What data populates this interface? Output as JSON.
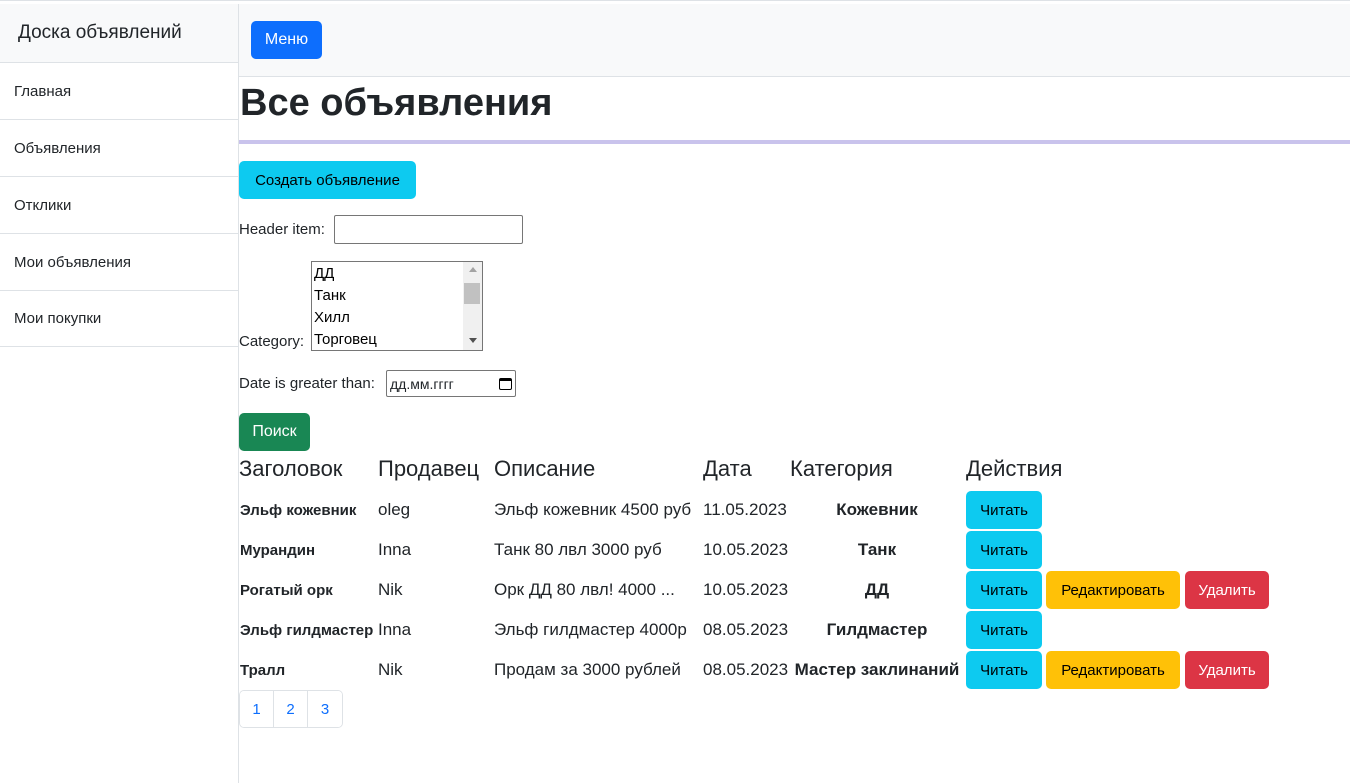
{
  "sidebar": {
    "heading": "Доска объявлений",
    "items": [
      {
        "label": "Главная"
      },
      {
        "label": "Объявления"
      },
      {
        "label": "Отклики"
      },
      {
        "label": "Мои объявления"
      },
      {
        "label": "Мои покупки"
      }
    ]
  },
  "topnav": {
    "menu_label": "Меню"
  },
  "main": {
    "title": "Все объявления",
    "create_label": "Создать объявление",
    "filters": {
      "header_label": "Header item:",
      "header_value": "",
      "category_label": "Category:",
      "category_options": [
        "ДД",
        "Танк",
        "Хилл",
        "Торговец"
      ],
      "date_label": "Date is greater than:",
      "date_placeholder": "дд.мм.гггг",
      "search_label": "Поиск"
    },
    "table": {
      "headers": [
        "Заголовок",
        "Продавец",
        "Описание",
        "Дата",
        "Категория",
        "Действия"
      ],
      "rows": [
        {
          "title": "Эльф кожевник",
          "seller": "oleg",
          "description": "Эльф кожевник 4500 руб",
          "date": "11.05.2023",
          "category": "Кожевник",
          "read": "Читать"
        },
        {
          "title": "Мурандин",
          "seller": "Inna",
          "description": "Танк 80 лвл 3000 руб",
          "date": "10.05.2023",
          "category": "Танк",
          "read": "Читать"
        },
        {
          "title": "Рогатый орк",
          "seller": "Nik",
          "description": "Орк ДД 80 лвл! 4000 ...",
          "date": "10.05.2023",
          "category": "ДД",
          "read": "Читать",
          "edit": "Редактировать",
          "delete": "Удалить"
        },
        {
          "title": "Эльф гилдмастер",
          "seller": "Inna",
          "description": "Эльф гилдмастер 4000р",
          "date": "08.05.2023",
          "category": "Гилдмастер",
          "read": "Читать"
        },
        {
          "title": "Тралл",
          "seller": "Nik",
          "description": "Продам за 3000 рублей",
          "date": "08.05.2023",
          "category": "Мастер заклинаний",
          "read": "Читать",
          "edit": "Редактировать",
          "delete": "Удалить"
        }
      ]
    },
    "pagination": [
      "1",
      "2",
      "3"
    ]
  },
  "colors": {
    "primary": "#0d6efd",
    "info": "#0dcaf0",
    "success": "#198754",
    "warning": "#ffc107",
    "danger": "#dc3545",
    "accent_line": "#c9c3ec"
  }
}
